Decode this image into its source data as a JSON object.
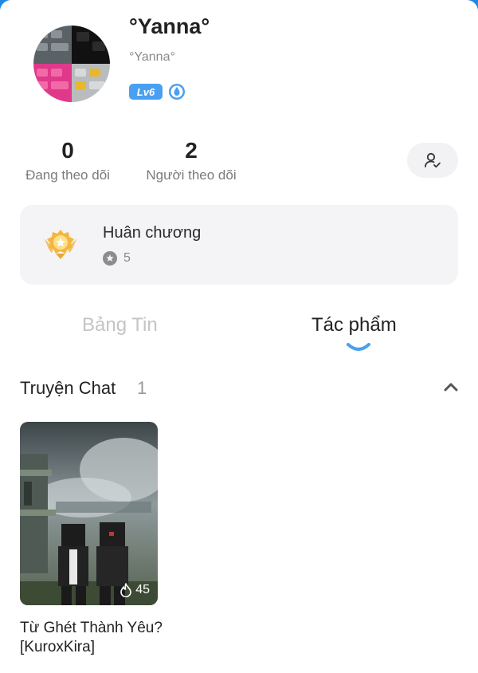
{
  "profile": {
    "name": "°Yanna°",
    "handle": "°Yanna°",
    "level": "Lv6"
  },
  "stats": {
    "following_count": "0",
    "following_label": "Đang theo dõi",
    "followers_count": "2",
    "followers_label": "Người theo dõi"
  },
  "medals": {
    "title": "Huân chương",
    "count": "5"
  },
  "tabs": [
    {
      "label": "Bảng Tin",
      "active": false
    },
    {
      "label": "Tác phẩm",
      "active": true
    }
  ],
  "section": {
    "title": "Truyện Chat",
    "count": "1"
  },
  "stories": [
    {
      "title": "Từ Ghét Thành Yêu? [KuroxKira]",
      "views": "45"
    }
  ],
  "colors": {
    "accent": "#4aa0f0",
    "topbar": "#1e88e5",
    "card_bg": "#f4f4f6",
    "inactive_tab": "#c4c4c4"
  }
}
